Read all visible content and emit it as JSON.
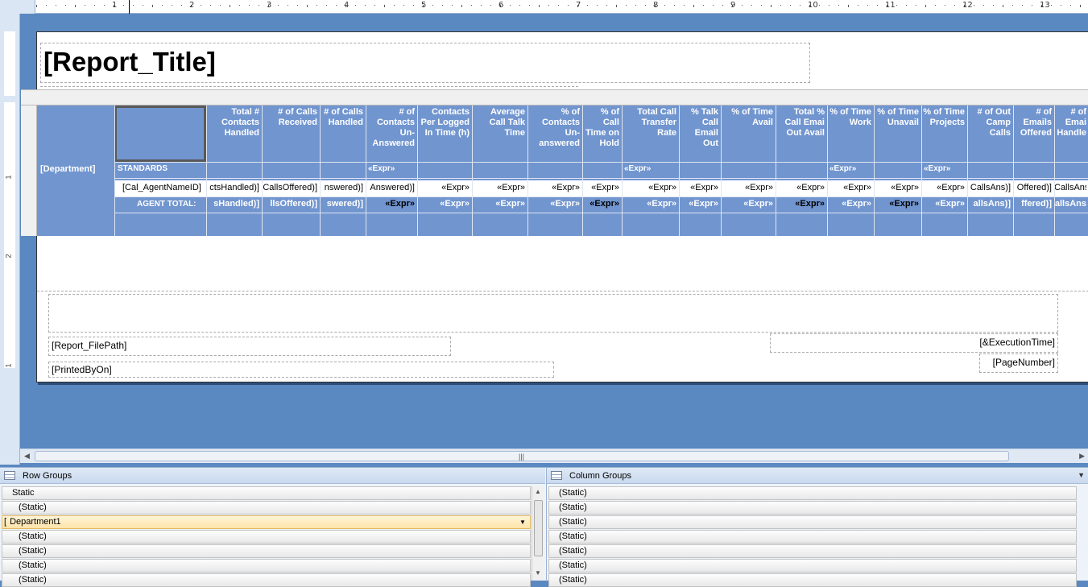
{
  "ruler": {
    "numbers": [
      "1",
      "2",
      "3",
      "4",
      "5",
      "6",
      "7",
      "8",
      "9",
      "10",
      "11",
      "12",
      "13"
    ],
    "vnumbers": [
      "1",
      "2",
      "1"
    ]
  },
  "report": {
    "title": "[Report_Title]",
    "headers": [
      "Total # Contacts Handled",
      "# of Calls Received",
      "# of Calls Handled",
      "# of Contacts Un-Answered",
      "Contacts Per Logged In Time (h)",
      "Average Call Talk Time",
      "% of Contacts Un-answered",
      "% of Call Time on Hold",
      "Total Call Transfer Rate",
      "% Talk Call Email Out",
      "% of Time Avail",
      "Total % Call Emai Out Avail",
      "% of Time Work",
      "% of Time Unavail",
      "% of Time Projects",
      "# of Out Camp Calls",
      "# of Emails Offered",
      "# of Emai Handle"
    ],
    "department": "[Department]",
    "standards": "STANDARDS",
    "standards_exprs": [
      "«Expr»",
      "«Expr»",
      "«Expr»",
      "«Expr»"
    ],
    "agent_name": "[Cal_AgentNameID]",
    "data_cells": [
      "ctsHandled)]",
      "CallsOffered)]",
      "nswered)]",
      "Answered)]",
      "«Expr»",
      "«Expr»",
      "«Expr»",
      "«Expr»",
      "«Expr»",
      "«Expr»",
      "«Expr»",
      "«Expr»",
      "«Expr»",
      "«Expr»",
      "«Expr»",
      "CallsAns)]",
      "Offered)]",
      "CallsAns"
    ],
    "total_label": "AGENT TOTAL:",
    "total_cells": [
      "sHandled)]",
      "llsOffered)]",
      "swered)]",
      "«Expr»",
      "«Expr»",
      "«Expr»",
      "«Expr»",
      "«Expr»",
      "«Expr»",
      "«Expr»",
      "«Expr»",
      "«Expr»",
      "«Expr»",
      "«Expr»",
      "«Expr»",
      "allsAns)]",
      "ffered)]",
      "allsAns"
    ]
  },
  "footer": {
    "file_path": "[Report_FilePath]",
    "printed_by": "[PrintedByOn]",
    "execution_time": "[&ExecutionTime]",
    "page_number": "[PageNumber]"
  },
  "row_groups": {
    "title": "Row Groups",
    "items": [
      "Static",
      "(Static)",
      "Department1",
      "(Static)",
      "(Static)",
      "(Static)",
      "(Static)"
    ],
    "selected_prefix": "["
  },
  "column_groups": {
    "title": "Column Groups",
    "items": [
      "(Static)",
      "(Static)",
      "(Static)",
      "(Static)",
      "(Static)",
      "(Static)",
      "(Static)"
    ]
  }
}
